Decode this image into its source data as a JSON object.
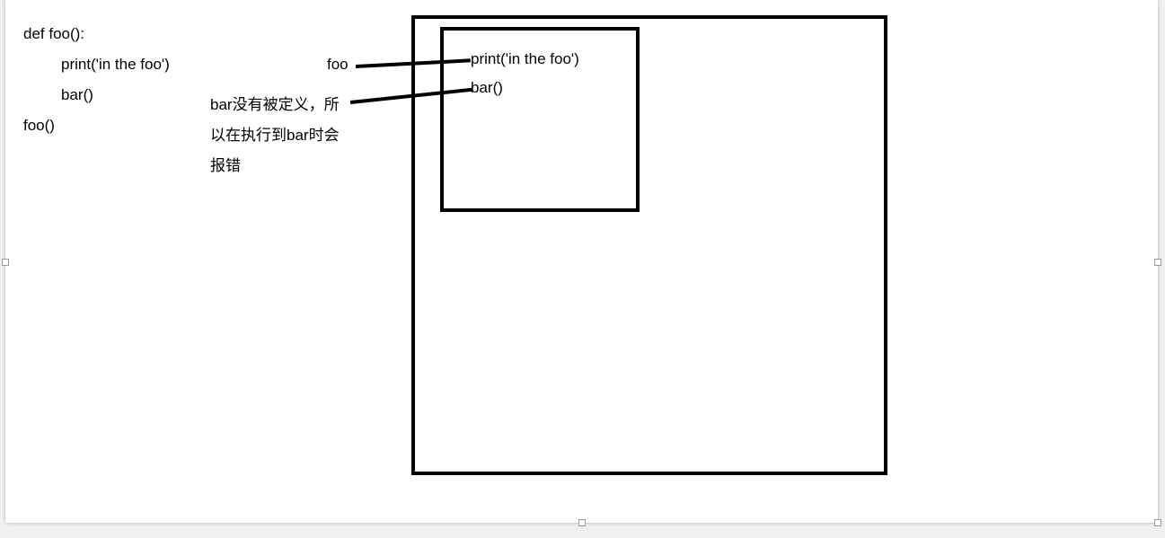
{
  "code": {
    "line1": "def foo():",
    "line2": "print('in the foo')",
    "line3": "bar()",
    "line4": "foo()"
  },
  "labels": {
    "foo": "foo",
    "note_l1": "bar没有被定义，所",
    "note_l2": "以在执行到bar时会",
    "note_l3": "报错"
  },
  "inner": {
    "line1": "print('in the foo')",
    "line2": "bar()"
  }
}
